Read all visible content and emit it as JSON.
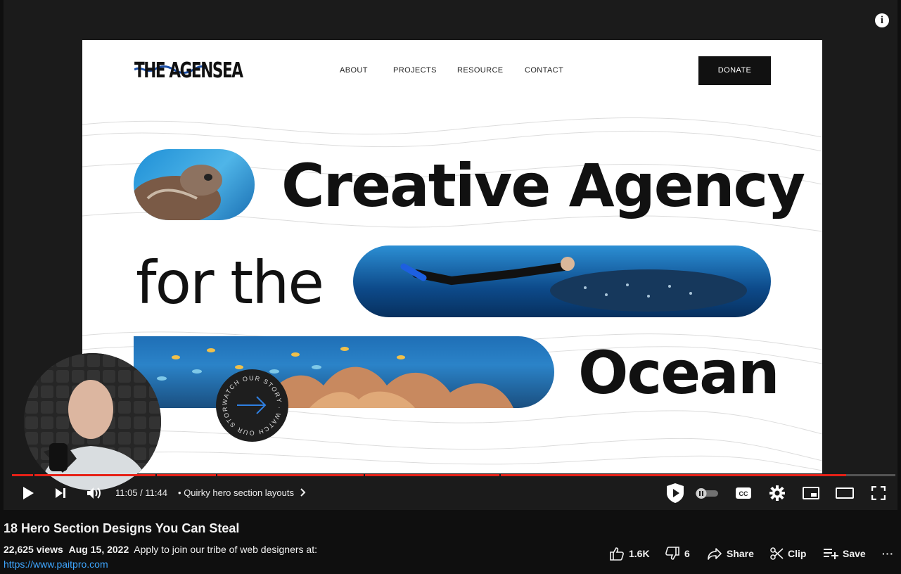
{
  "video": {
    "site": {
      "logo": "THE AGENSEA",
      "nav": [
        "ABOUT",
        "PROJECTS",
        "RESOURCE",
        "CONTACT"
      ],
      "donate_label": "DONATE",
      "headline": {
        "line1": "Creative Agency",
        "line2": "for the",
        "line3": "Ocean"
      },
      "watch_badge": "WATCH OUR STORY · WATCH OUR STORY ·"
    },
    "info_icon": "i"
  },
  "controls": {
    "current_time": "11:05",
    "duration": "11:44",
    "time_display": "11:05 / 11:44",
    "chapter_separator": "•",
    "chapter_title": "Quirky hero section layouts",
    "progress_fraction": 0.944,
    "icons": [
      "play-icon",
      "next-icon",
      "volume-icon",
      "cast-sponsor-icon",
      "autoplay-toggle",
      "captions-icon",
      "settings-icon",
      "miniplayer-icon",
      "theater-icon",
      "fullscreen-icon"
    ],
    "captions_label": "CC",
    "accent": "#e62117"
  },
  "details": {
    "title": "18 Hero Section Designs You Can Steal",
    "views": "22,625 views",
    "date": "Aug 15, 2022",
    "description": "Apply to join our tribe of web designers at:",
    "link": "https://www.paitpro.com",
    "actions": {
      "likes": "1.6K",
      "dislikes": "6",
      "share": "Share",
      "clip": "Clip",
      "save": "Save",
      "more": "···"
    },
    "link_color": "#3ea6ff"
  }
}
